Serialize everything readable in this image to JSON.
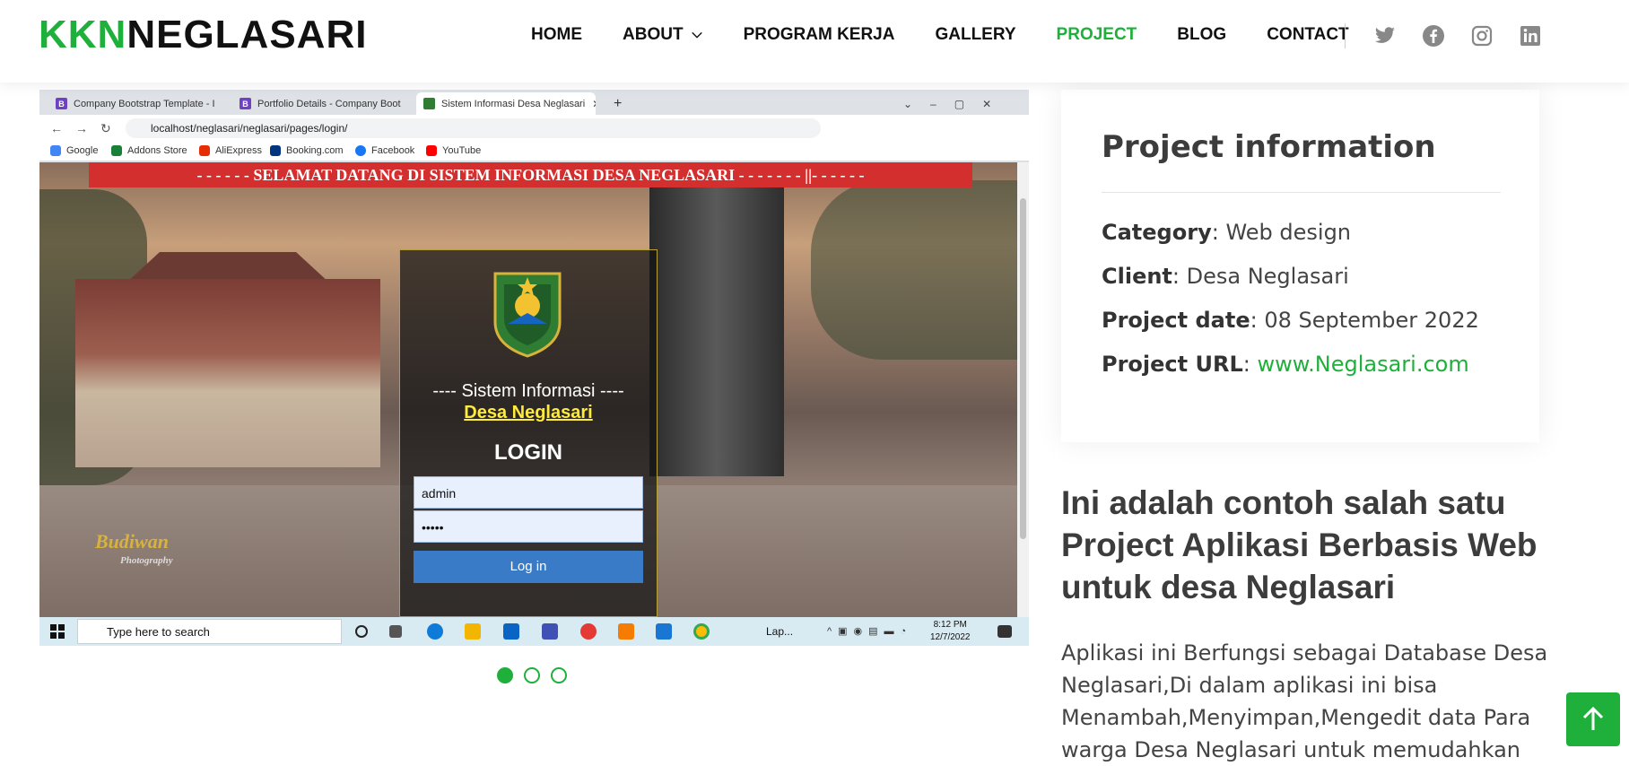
{
  "brand": {
    "part1": "KKN",
    "part2": "NEGLASARI"
  },
  "nav": {
    "items": [
      {
        "label": "HOME"
      },
      {
        "label": "ABOUT"
      },
      {
        "label": "PROGRAM KERJA"
      },
      {
        "label": "GALLERY"
      },
      {
        "label": "PROJECT"
      },
      {
        "label": "BLOG"
      },
      {
        "label": "CONTACT"
      }
    ],
    "active": "PROJECT"
  },
  "socials": [
    "twitter-icon",
    "facebook-icon",
    "instagram-icon",
    "linkedin-icon"
  ],
  "screenshot": {
    "tabs": [
      {
        "label": "Company Bootstrap Template - I"
      },
      {
        "label": "Portfolio Details - Company Boot"
      },
      {
        "label": "Sistem Informasi Desa Neglasari"
      }
    ],
    "new_tab": "+",
    "address": "localhost/neglasari/neglasari/pages/login/",
    "bookmarks": [
      "Google",
      "Addons Store",
      "AliExpress",
      "Booking.com",
      "Facebook",
      "YouTube"
    ],
    "banner": "- - - - - - SELAMAT DATANG DI SISTEM INFORMASI DESA NEGLASARI - - - - - - - ||- - - - - -",
    "login": {
      "title": "---- Sistem Informasi ----",
      "subtitle": "Desa Neglasari",
      "heading": "LOGIN",
      "username": "admin",
      "password": "•••••",
      "button": "Log in"
    },
    "watermark": "Budiwan",
    "watermark_sub": "Photography",
    "taskbar": {
      "search_placeholder": "Type here to search",
      "app_label": "Lap...",
      "time": "8:12 PM",
      "date": "12/7/2022"
    }
  },
  "carousel": {
    "count": 3,
    "active": 0
  },
  "project_info": {
    "title": "Project information",
    "category_label": "Category",
    "category": "Web design",
    "client_label": "Client",
    "client": "Desa Neglasari",
    "date_label": "Project date",
    "date": "08 September 2022",
    "url_label": "Project URL",
    "url": "www.Neglasari.com"
  },
  "description": {
    "heading": "Ini adalah contoh salah satu Project Aplikasi Berbasis Web untuk desa Neglasari",
    "text": "Aplikasi ini Berfungsi sebagai Database Desa Neglasari,Di dalam aplikasi ini bisa Menambah,Menyimpan,Mengedit data Para warga Desa Neglasari untuk memudahkan"
  },
  "colors": {
    "accent": "#1fb03b",
    "text": "#444444",
    "banner": "#d32f2f"
  }
}
